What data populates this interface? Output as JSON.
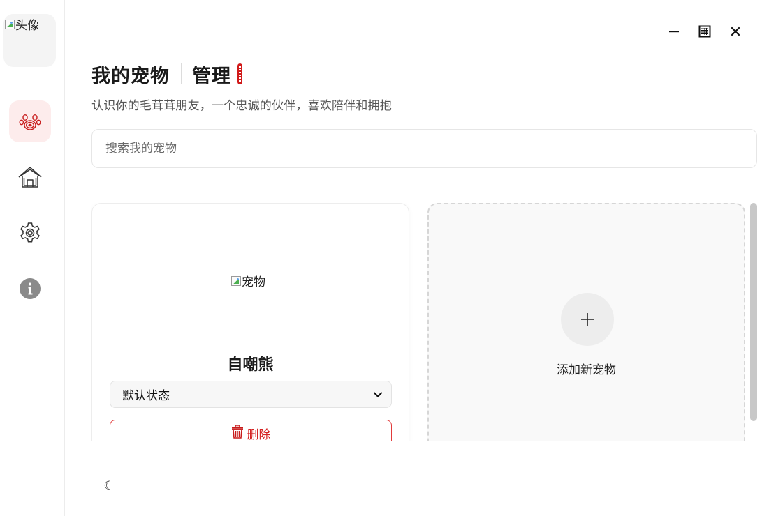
{
  "sidebar": {
    "avatar_alt": "头像",
    "items": [
      {
        "name": "pets",
        "icon": "paw-icon",
        "active": true
      },
      {
        "name": "home",
        "icon": "house-icon",
        "active": false
      },
      {
        "name": "settings",
        "icon": "gear-icon",
        "active": false
      },
      {
        "name": "info",
        "icon": "info-icon",
        "active": false
      }
    ]
  },
  "window": {
    "controls": [
      "minimize-icon",
      "maximize-icon",
      "close-icon"
    ]
  },
  "header": {
    "title": "我的宠物",
    "title_suffix": "管理",
    "subtitle": "认识你的毛茸茸朋友，一个忠诚的伙伴，喜欢陪伴和拥抱"
  },
  "search": {
    "placeholder": "搜索我的宠物",
    "value": ""
  },
  "pets": [
    {
      "image_alt": "宠物",
      "name": "自嘲熊",
      "state": "默认状态",
      "delete_label": "删除"
    }
  ],
  "add_pet": {
    "label": "添加新宠物",
    "icon": "plus-icon"
  },
  "footer": {
    "theme_icon": "☾"
  },
  "colors": {
    "accent": "#d11a1a",
    "active_bg": "#fdecec",
    "card_bg": "#ffffff",
    "add_bg": "#f9f9f9"
  }
}
